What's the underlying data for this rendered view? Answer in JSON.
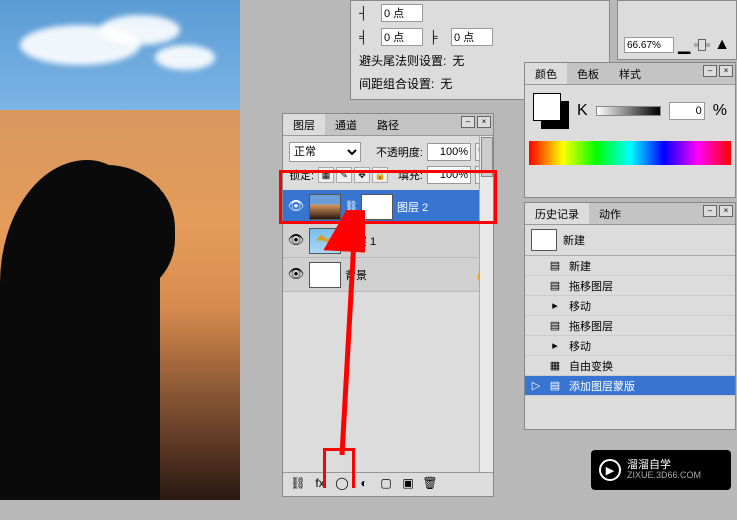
{
  "toolbar": {
    "indent_left": "0 点",
    "indent_left2": "0 点",
    "indent_right": "0 点",
    "avoid_label": "避头尾法则设置:",
    "avoid_value": "无",
    "spacing_label": "间距组合设置:",
    "spacing_value": "无",
    "unit": "点"
  },
  "zoom": {
    "value": "66.67%"
  },
  "color_panel": {
    "tabs": [
      "颜色",
      "色板",
      "样式"
    ],
    "mode": "K",
    "value": "0",
    "percent": "%"
  },
  "layers_panel": {
    "tabs": [
      "图层",
      "通道",
      "路径"
    ],
    "blend": "正常",
    "opacity_label": "不透明度:",
    "opacity_value": "100%",
    "lock_label": "锁定:",
    "fill_label": "填充:",
    "fill_value": "100%",
    "layers": [
      {
        "name": "图层 2",
        "selected": true,
        "has_mask": true,
        "locked": false
      },
      {
        "name": "图层 1",
        "selected": false,
        "has_mask": false,
        "locked": false
      },
      {
        "name": "背景",
        "selected": false,
        "has_mask": false,
        "locked": true
      }
    ]
  },
  "history_panel": {
    "tabs": [
      "历史记录",
      "动作"
    ],
    "snapshot": "新建",
    "items": [
      {
        "label": "新建",
        "selected": false
      },
      {
        "label": "拖移图层",
        "selected": false
      },
      {
        "label": "移动",
        "selected": false
      },
      {
        "label": "拖移图层",
        "selected": false
      },
      {
        "label": "移动",
        "selected": false
      },
      {
        "label": "自由变换",
        "selected": false
      },
      {
        "label": "添加图层蒙版",
        "selected": true
      }
    ]
  },
  "watermark": {
    "title": "溜溜自学",
    "sub": "ZIXUE.3D66.COM"
  }
}
